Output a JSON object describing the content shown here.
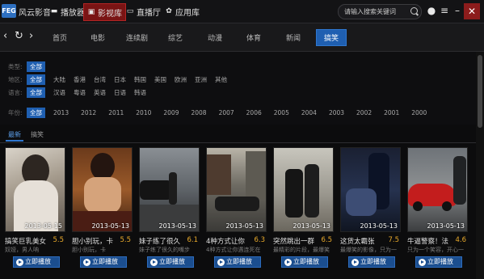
{
  "app": {
    "name": "风云影音",
    "logo_text": "FEG"
  },
  "topnav": [
    {
      "label": "播放器",
      "icon": "tv-icon"
    },
    {
      "label": "影视库",
      "icon": "film-icon",
      "active": true
    },
    {
      "label": "直播厅",
      "icon": "live-tv-icon"
    },
    {
      "label": "应用库",
      "icon": "app-icon"
    }
  ],
  "search": {
    "placeholder": "请输入搜索关键词"
  },
  "categories": [
    {
      "label": "首页"
    },
    {
      "label": "电影"
    },
    {
      "label": "连续剧"
    },
    {
      "label": "综艺"
    },
    {
      "label": "动漫"
    },
    {
      "label": "体育"
    },
    {
      "label": "新闻"
    },
    {
      "label": "搞笑",
      "active": true
    }
  ],
  "filters": {
    "type": {
      "label": "类型:",
      "options": [
        "全部"
      ]
    },
    "region": {
      "label": "地区:",
      "options": [
        "全部",
        "大陆",
        "香港",
        "台湾",
        "日本",
        "韩国",
        "美国",
        "欧洲",
        "亚洲",
        "其他"
      ]
    },
    "language": {
      "label": "语言:",
      "options": [
        "全部",
        "汉语",
        "粤语",
        "英语",
        "日语",
        "韩语"
      ]
    },
    "year": {
      "label": "年份:",
      "options": [
        "全部",
        "2013",
        "2012",
        "2011",
        "2010",
        "2009",
        "2008",
        "2007",
        "2006",
        "2005",
        "2004",
        "2003",
        "2002",
        "2001",
        "2000"
      ]
    }
  },
  "sort_tabs": [
    {
      "label": "最新",
      "active": true
    },
    {
      "label": "搞笑"
    }
  ],
  "play_label": "立即播放",
  "videos": [
    {
      "title": "搞笑巨乳美女",
      "score": "5.5",
      "date": "2013-05-15",
      "desc": "奴娅，男人呐"
    },
    {
      "title": "胆小别玩，卡",
      "score": "5.5",
      "date": "2013-05-13",
      "desc": "胆小别玩，卡"
    },
    {
      "title": "妹子练了很久",
      "score": "6.1",
      "date": "2013-05-13",
      "desc": "妹子练了很久的嘴步"
    },
    {
      "title": "4种方式让你",
      "score": "6.3",
      "date": "2013-05-13",
      "desc": "4种方式让你遇连死在"
    },
    {
      "title": "突然跳出一群",
      "score": "6.5",
      "date": "2013-05-13",
      "desc": "最精彩的片段，最爆笑"
    },
    {
      "title": "这货太霸张",
      "score": "7.5",
      "date": "2013-05-13",
      "desc": "最爆笑的影像，只为一"
    },
    {
      "title": "牛逼警察！法",
      "score": "4.6",
      "date": "2013-05-13",
      "desc": "只为一个笑容，开心一"
    }
  ]
}
